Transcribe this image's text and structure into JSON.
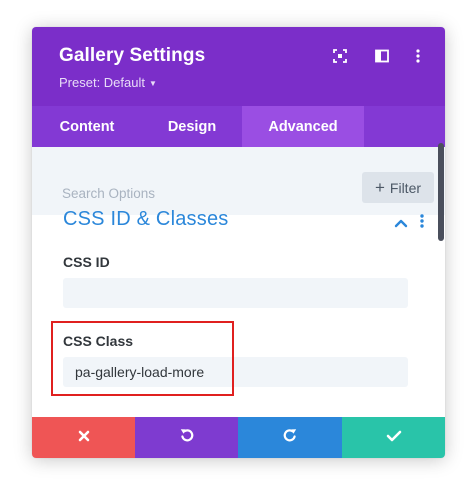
{
  "header": {
    "title": "Gallery Settings",
    "preset_label": "Preset: Default",
    "background_color": "#7b2ec9",
    "icons": [
      "expand-icon",
      "sidebar-toggle-icon",
      "more-options-icon"
    ]
  },
  "tabs": [
    {
      "label": "Content",
      "active": false
    },
    {
      "label": "Design",
      "active": false
    },
    {
      "label": "Advanced",
      "active": true
    }
  ],
  "search": {
    "placeholder": "Search Options",
    "filter_label": "Filter"
  },
  "section": {
    "title": "CSS ID & Classes",
    "accent_color": "#2b87da",
    "fields": [
      {
        "label": "CSS ID",
        "value": ""
      },
      {
        "label": "CSS Class",
        "value": "pa-gallery-load-more"
      }
    ]
  },
  "footer": {
    "buttons": [
      {
        "name": "discard",
        "icon": "close-icon",
        "color": "#ef5555"
      },
      {
        "name": "undo",
        "icon": "undo-icon",
        "color": "#7e3bd0"
      },
      {
        "name": "redo",
        "icon": "redo-icon",
        "color": "#2b87da"
      },
      {
        "name": "save",
        "icon": "checkmark-icon",
        "color": "#29c4a9"
      }
    ]
  }
}
